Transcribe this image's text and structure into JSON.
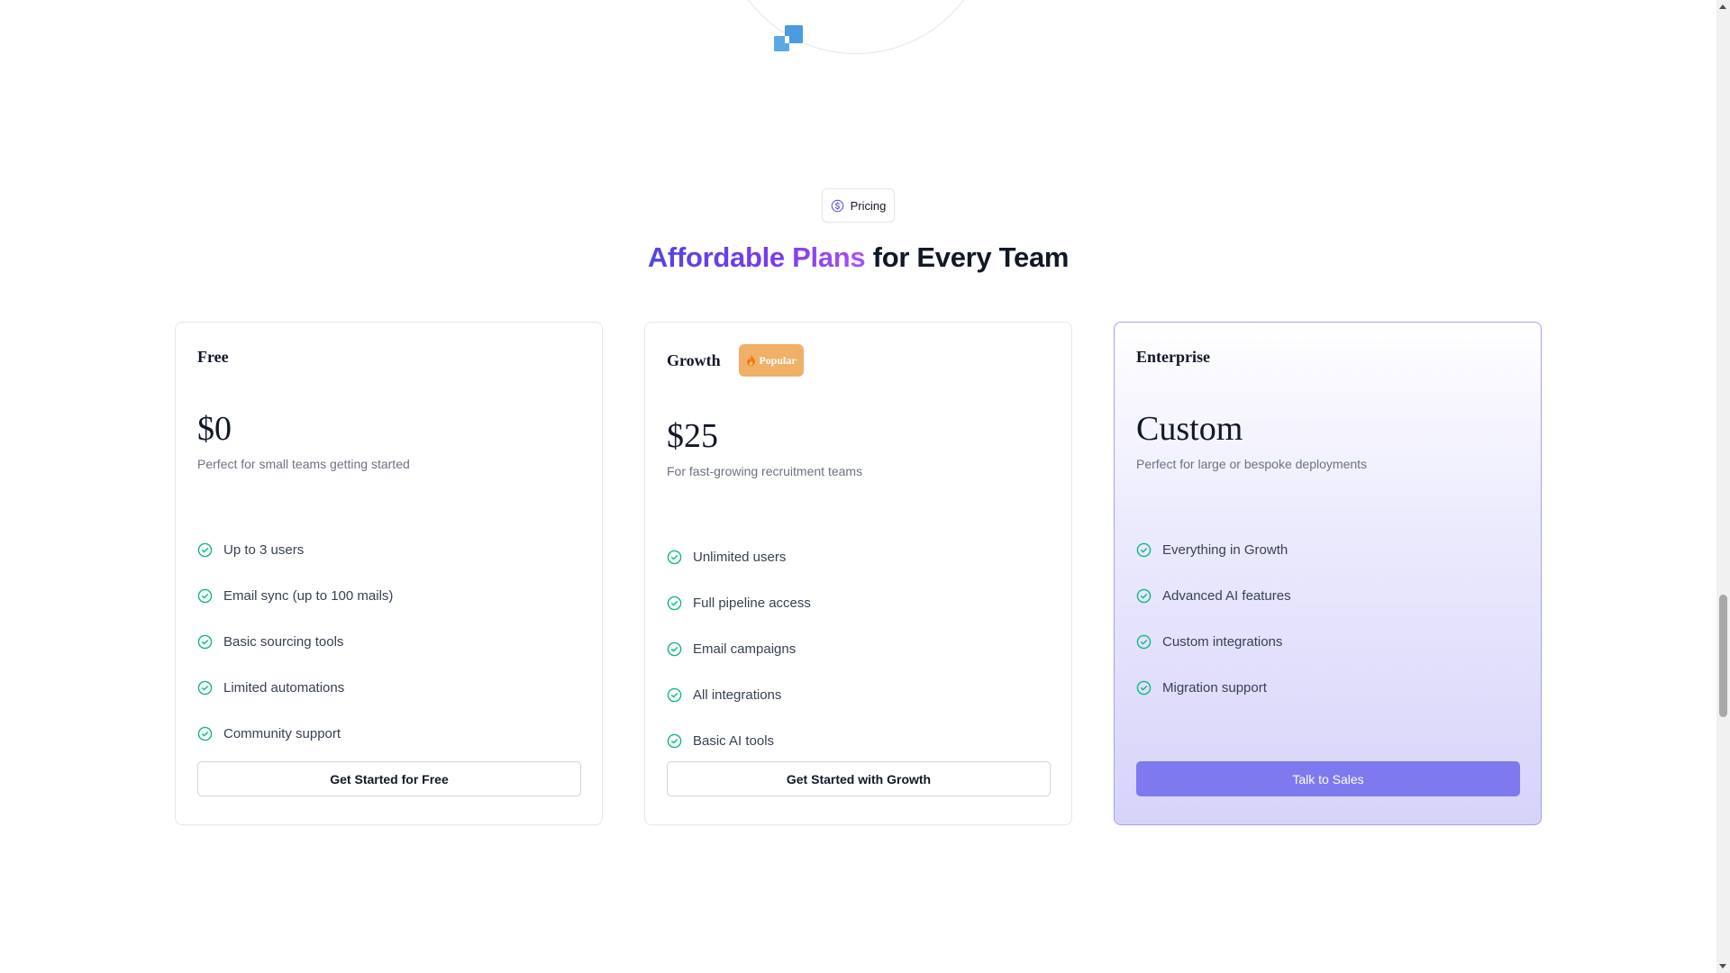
{
  "badge": {
    "label": "Pricing",
    "icon": "dollar-circle-icon"
  },
  "heading": {
    "highlight": "Affordable Plans",
    "rest": " for Every Team"
  },
  "colors": {
    "accent_start": "#4f46e5",
    "accent_end": "#a855f7",
    "check": "#10b981",
    "primary_button": "#7f79ef",
    "popular_badge": "#f0b067"
  },
  "plans": [
    {
      "name": "Free",
      "price": "$0",
      "description": "Perfect for small teams getting started",
      "features": [
        "Up to 3 users",
        "Email sync (up to 100 mails)",
        "Basic sourcing tools",
        "Limited automations",
        "Community support"
      ],
      "cta": "Get Started for Free"
    },
    {
      "name": "Growth",
      "badge": "Popular",
      "price": "$25",
      "description": "For fast-growing recruitment teams",
      "features": [
        "Unlimited users",
        "Full pipeline access",
        "Email campaigns",
        "All integrations",
        "Basic AI tools"
      ],
      "cta": "Get Started with Growth"
    },
    {
      "name": "Enterprise",
      "price": "Custom",
      "description": "Perfect for large or bespoke deployments",
      "features": [
        "Everything in Growth",
        "Advanced AI features",
        "Custom integrations",
        "Migration support"
      ],
      "cta": "Talk to Sales"
    }
  ]
}
